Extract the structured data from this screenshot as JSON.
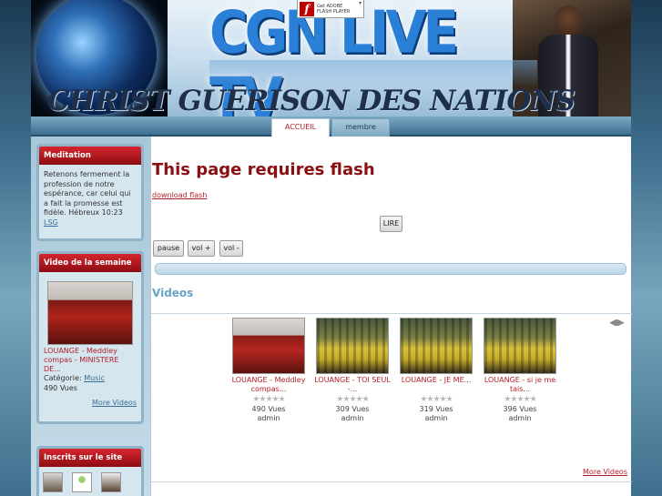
{
  "banner": {
    "title": "CGN LIVE TV",
    "subtitle": "CHRIST GUERISON DES NATIONS",
    "flash_badge_line1": "Get ADOBE",
    "flash_badge_line2": "FLASH PLAYER",
    "flash_logo": "f"
  },
  "nav": {
    "tabs": [
      {
        "label": "ACCUEIL",
        "active": true
      },
      {
        "label": "membre",
        "active": false
      }
    ]
  },
  "sidebar": {
    "meditation": {
      "title": "Meditation",
      "text": "Retenons fermement la profession de notre espérance, car celui qui a fait la promesse est fidèle. Hébreux 10:23",
      "ref_link": "LSG"
    },
    "video_week": {
      "title": "Video de la semaine",
      "video_title": "LOUANGE - Meddley compas - MINISTERE DE...",
      "category_label": "Catégorie:",
      "category_link": "Music",
      "views": "490 Vues",
      "more": "More Videos"
    },
    "members": {
      "title": "Inscrits sur le site"
    }
  },
  "main": {
    "flash_title": "This page requires flash",
    "download_link": "download flash",
    "buttons": {
      "lire": "LIRE",
      "pause": "pause",
      "vol_up": "vol +",
      "vol_down": "vol -"
    },
    "videos_heading": "Videos",
    "carousel_arrows": "◀▮▶",
    "videos": [
      {
        "title": "LOUANGE - Meddley compas...",
        "views": "490 Vues",
        "author": "admin",
        "stars": "★★★★★",
        "thumb": "red"
      },
      {
        "title": "LOUANGE - TOI SEUL -...",
        "views": "309 Vues",
        "author": "admin",
        "stars": "★★★★★",
        "thumb": "yellow"
      },
      {
        "title": "LOUANGE - JE ME...",
        "views": "319 Vues",
        "author": "admin",
        "stars": "★★★★★",
        "thumb": "yellow"
      },
      {
        "title": "LOUANGE - si je me tais...",
        "views": "396 Vues",
        "author": "admin",
        "stars": "★★★★★",
        "thumb": "yellow"
      }
    ],
    "more_videos": "More Videos"
  },
  "colors": {
    "accent_red": "#b4202a",
    "header_red": "#8b0f12",
    "videos_blue": "#6aa3c8"
  }
}
